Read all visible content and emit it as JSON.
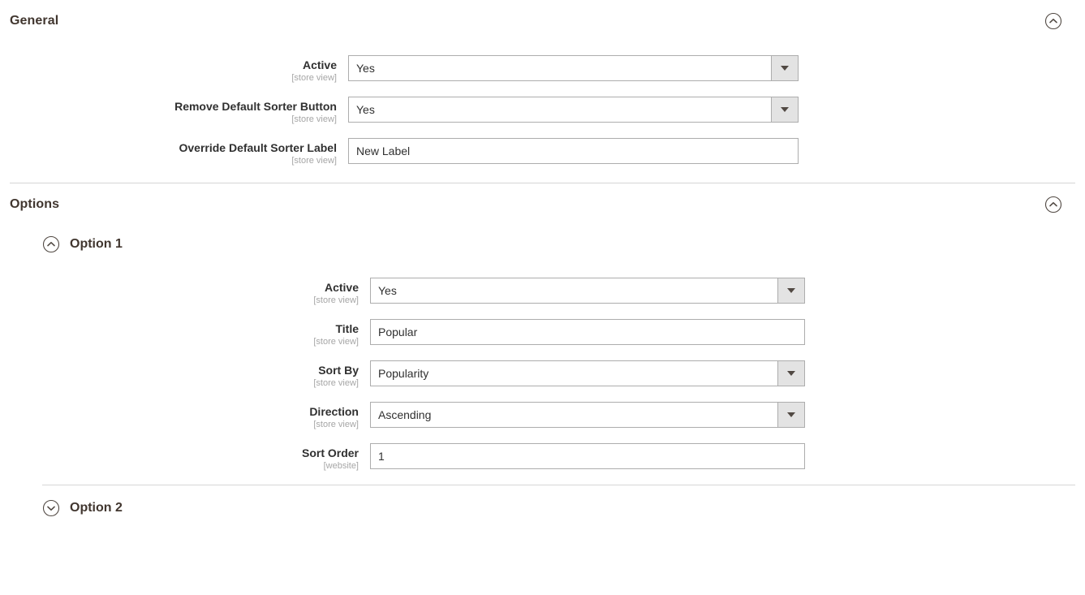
{
  "sections": [
    {
      "id": "general",
      "title": "General",
      "collapse_icon": "chevron-up-circle-icon",
      "collapsed": false,
      "fields": [
        {
          "label": "Active",
          "scope": "[store view]",
          "type": "select",
          "value": "Yes"
        },
        {
          "label": "Remove Default Sorter Button",
          "scope": "[store view]",
          "type": "select",
          "value": "Yes"
        },
        {
          "label": "Override Default Sorter Label",
          "scope": "[store view]",
          "type": "text",
          "value": "New Label"
        }
      ]
    },
    {
      "id": "options",
      "title": "Options",
      "collapse_icon": "chevron-up-circle-icon",
      "collapsed": false,
      "options": [
        {
          "id": "option-1",
          "title": "Option 1",
          "collapse_icon": "chevron-up-circle-icon",
          "collapsed": false,
          "fields": [
            {
              "label": "Active",
              "scope": "[store view]",
              "type": "select",
              "value": "Yes"
            },
            {
              "label": "Title",
              "scope": "[store view]",
              "type": "text",
              "value": "Popular"
            },
            {
              "label": "Sort By",
              "scope": "[store view]",
              "type": "select",
              "value": "Popularity"
            },
            {
              "label": "Direction",
              "scope": "[store view]",
              "type": "select",
              "value": "Ascending"
            },
            {
              "label": "Sort Order",
              "scope": "[website]",
              "type": "text",
              "value": "1"
            }
          ]
        },
        {
          "id": "option-2",
          "title": "Option 2",
          "collapse_icon": "chevron-down-circle-icon",
          "collapsed": true,
          "fields": []
        }
      ]
    }
  ],
  "colors": {
    "heading": "#41362f",
    "label": "#303030",
    "scope": "#a6a6a6",
    "border": "#adadad",
    "divider": "#d6d6d6",
    "select_button_bg": "#e3e3e3",
    "caret": "#514943",
    "icon_stroke": "#514943"
  }
}
